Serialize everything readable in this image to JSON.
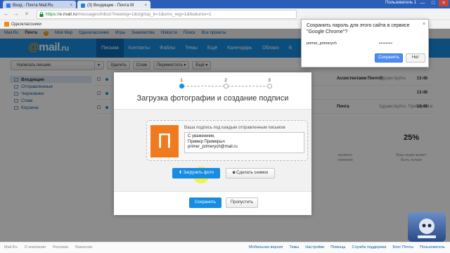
{
  "browser": {
    "tabs": [
      {
        "label": "Вход - Почта Mail.Ru",
        "close": "×"
      },
      {
        "label": "(3) Входящие - Почта M",
        "close": "×"
      }
    ],
    "user_label": "Пользователь 1",
    "window_buttons": {
      "minimize": "—",
      "maximize": "□",
      "close": "×"
    },
    "nav": {
      "back": "←",
      "forward": "→",
      "reload": "×"
    },
    "url": {
      "scheme": "https://",
      "host": "e.mail.ru",
      "path": "/messages/inbox?newreg=1&signup_b=1&sms_reg=1&features=1"
    },
    "bookmark": "Одноклассники"
  },
  "portal_nav": {
    "items": [
      "Mail.Ru",
      "Почта",
      "Мой Мир",
      "Одноклассники",
      "Игры",
      "Знакомства",
      "Новости",
      "Поиск",
      "Все проекты"
    ],
    "active_index": 1,
    "mail_badge": "3"
  },
  "header": {
    "logo_at": "@",
    "logo_text": "mail",
    "logo_ru": ".ru",
    "nav": [
      "Письма",
      "Контакты",
      "Файлы",
      "Темы",
      "Ещё",
      "Календарь",
      "Облако",
      "Б"
    ]
  },
  "sidebar": {
    "compose": "Написать письмо",
    "folders": [
      "Входящие",
      "Отправленные",
      "Черновики",
      "Спам",
      "Корзина"
    ]
  },
  "listbar": {
    "delete": "Удалить",
    "spam": "Спам",
    "move": "Переместить",
    "more": "Ещё"
  },
  "messages": [
    {
      "from": "Ассистентами Почтой",
      "subject": "Здравствуйте",
      "time": "13:48"
    },
    {
      "from": "",
      "subject": "",
      "time": "13:48"
    },
    {
      "from": "Почта",
      "subject": "Здравствуйте, Пример! Mai",
      "time": "13:48"
    }
  ],
  "right_widget": {
    "left_caption_1": "ановить",
    "left_caption_2": "ложение",
    "percent": "25%",
    "right_caption_1": "Ваш ящик может",
    "right_caption_2": "быть лучше"
  },
  "modal": {
    "steps": [
      "1",
      "2",
      "3"
    ],
    "current_step": 1,
    "title": "Загрузка фотографии и создание подписи",
    "avatar_letter": "П",
    "signature_caption": "Ваша подпись под каждым отправленным письмом",
    "signature_lines": [
      "С уважением,",
      "Пример Примерыч",
      "primer_primerych@mail.ru"
    ],
    "upload_button": "Загрузить фото",
    "photo_button": "Сделать снимок",
    "save_button": "Сохранить",
    "skip_button": "Пропустить"
  },
  "password_popup": {
    "title": "Сохранить пароль для этого сайта в сервисе \"Google Chrome\"?",
    "close": "×",
    "username": "primer_primerych",
    "password_mask": "••••••••",
    "save": "Сохранить",
    "no": "Нет"
  },
  "footer": {
    "left": [
      "Mail.Ru",
      "О компании",
      "Реклама",
      "Вакансии"
    ],
    "right": [
      "Мобильная версия",
      "Темы",
      "Настройки",
      "Помощь",
      "Служба поддержки",
      "Блог Почты",
      "Пользователь"
    ]
  },
  "colors": {
    "brand_blue": "#168de2",
    "accent_orange": "#f07b1e",
    "chrome_blue": "#2b5eb7"
  }
}
